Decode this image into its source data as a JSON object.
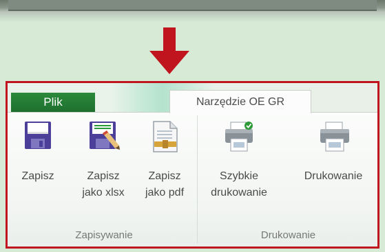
{
  "tabs": [
    {
      "label": "Plik"
    },
    {
      "label": "Narzędzie OE GR"
    }
  ],
  "groups": {
    "saving": {
      "label": "Zapisywanie",
      "buttons": [
        {
          "label": "Zapisz",
          "icon": "floppy-disk-icon"
        },
        {
          "line1": "Zapisz",
          "line2": "jako xlsx",
          "icon": "floppy-disk-edit-icon"
        },
        {
          "line1": "Zapisz",
          "line2": "jako pdf",
          "icon": "document-pdf-icon"
        }
      ]
    },
    "printing": {
      "label": "Drukowanie",
      "buttons": [
        {
          "line1": "Szybkie",
          "line2": "drukowanie",
          "icon": "quick-print-icon"
        },
        {
          "label": "Drukowanie",
          "icon": "printer-icon"
        }
      ]
    }
  },
  "colors": {
    "highlight_border": "#c0151e",
    "arrow": "#c0151e",
    "file_tab": "#22803a",
    "background": "#d6ead6"
  }
}
